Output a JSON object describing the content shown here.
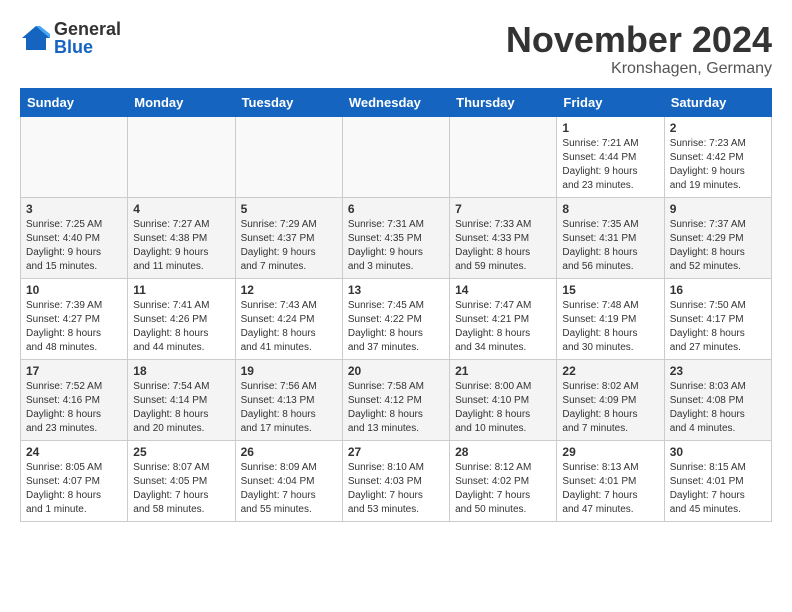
{
  "logo": {
    "general": "General",
    "blue": "Blue"
  },
  "title": "November 2024",
  "location": "Kronshagen, Germany",
  "weekdays": [
    "Sunday",
    "Monday",
    "Tuesday",
    "Wednesday",
    "Thursday",
    "Friday",
    "Saturday"
  ],
  "weeks": [
    [
      {
        "day": "",
        "info": ""
      },
      {
        "day": "",
        "info": ""
      },
      {
        "day": "",
        "info": ""
      },
      {
        "day": "",
        "info": ""
      },
      {
        "day": "",
        "info": ""
      },
      {
        "day": "1",
        "info": "Sunrise: 7:21 AM\nSunset: 4:44 PM\nDaylight: 9 hours\nand 23 minutes."
      },
      {
        "day": "2",
        "info": "Sunrise: 7:23 AM\nSunset: 4:42 PM\nDaylight: 9 hours\nand 19 minutes."
      }
    ],
    [
      {
        "day": "3",
        "info": "Sunrise: 7:25 AM\nSunset: 4:40 PM\nDaylight: 9 hours\nand 15 minutes."
      },
      {
        "day": "4",
        "info": "Sunrise: 7:27 AM\nSunset: 4:38 PM\nDaylight: 9 hours\nand 11 minutes."
      },
      {
        "day": "5",
        "info": "Sunrise: 7:29 AM\nSunset: 4:37 PM\nDaylight: 9 hours\nand 7 minutes."
      },
      {
        "day": "6",
        "info": "Sunrise: 7:31 AM\nSunset: 4:35 PM\nDaylight: 9 hours\nand 3 minutes."
      },
      {
        "day": "7",
        "info": "Sunrise: 7:33 AM\nSunset: 4:33 PM\nDaylight: 8 hours\nand 59 minutes."
      },
      {
        "day": "8",
        "info": "Sunrise: 7:35 AM\nSunset: 4:31 PM\nDaylight: 8 hours\nand 56 minutes."
      },
      {
        "day": "9",
        "info": "Sunrise: 7:37 AM\nSunset: 4:29 PM\nDaylight: 8 hours\nand 52 minutes."
      }
    ],
    [
      {
        "day": "10",
        "info": "Sunrise: 7:39 AM\nSunset: 4:27 PM\nDaylight: 8 hours\nand 48 minutes."
      },
      {
        "day": "11",
        "info": "Sunrise: 7:41 AM\nSunset: 4:26 PM\nDaylight: 8 hours\nand 44 minutes."
      },
      {
        "day": "12",
        "info": "Sunrise: 7:43 AM\nSunset: 4:24 PM\nDaylight: 8 hours\nand 41 minutes."
      },
      {
        "day": "13",
        "info": "Sunrise: 7:45 AM\nSunset: 4:22 PM\nDaylight: 8 hours\nand 37 minutes."
      },
      {
        "day": "14",
        "info": "Sunrise: 7:47 AM\nSunset: 4:21 PM\nDaylight: 8 hours\nand 34 minutes."
      },
      {
        "day": "15",
        "info": "Sunrise: 7:48 AM\nSunset: 4:19 PM\nDaylight: 8 hours\nand 30 minutes."
      },
      {
        "day": "16",
        "info": "Sunrise: 7:50 AM\nSunset: 4:17 PM\nDaylight: 8 hours\nand 27 minutes."
      }
    ],
    [
      {
        "day": "17",
        "info": "Sunrise: 7:52 AM\nSunset: 4:16 PM\nDaylight: 8 hours\nand 23 minutes."
      },
      {
        "day": "18",
        "info": "Sunrise: 7:54 AM\nSunset: 4:14 PM\nDaylight: 8 hours\nand 20 minutes."
      },
      {
        "day": "19",
        "info": "Sunrise: 7:56 AM\nSunset: 4:13 PM\nDaylight: 8 hours\nand 17 minutes."
      },
      {
        "day": "20",
        "info": "Sunrise: 7:58 AM\nSunset: 4:12 PM\nDaylight: 8 hours\nand 13 minutes."
      },
      {
        "day": "21",
        "info": "Sunrise: 8:00 AM\nSunset: 4:10 PM\nDaylight: 8 hours\nand 10 minutes."
      },
      {
        "day": "22",
        "info": "Sunrise: 8:02 AM\nSunset: 4:09 PM\nDaylight: 8 hours\nand 7 minutes."
      },
      {
        "day": "23",
        "info": "Sunrise: 8:03 AM\nSunset: 4:08 PM\nDaylight: 8 hours\nand 4 minutes."
      }
    ],
    [
      {
        "day": "24",
        "info": "Sunrise: 8:05 AM\nSunset: 4:07 PM\nDaylight: 8 hours\nand 1 minute."
      },
      {
        "day": "25",
        "info": "Sunrise: 8:07 AM\nSunset: 4:05 PM\nDaylight: 7 hours\nand 58 minutes."
      },
      {
        "day": "26",
        "info": "Sunrise: 8:09 AM\nSunset: 4:04 PM\nDaylight: 7 hours\nand 55 minutes."
      },
      {
        "day": "27",
        "info": "Sunrise: 8:10 AM\nSunset: 4:03 PM\nDaylight: 7 hours\nand 53 minutes."
      },
      {
        "day": "28",
        "info": "Sunrise: 8:12 AM\nSunset: 4:02 PM\nDaylight: 7 hours\nand 50 minutes."
      },
      {
        "day": "29",
        "info": "Sunrise: 8:13 AM\nSunset: 4:01 PM\nDaylight: 7 hours\nand 47 minutes."
      },
      {
        "day": "30",
        "info": "Sunrise: 8:15 AM\nSunset: 4:01 PM\nDaylight: 7 hours\nand 45 minutes."
      }
    ]
  ]
}
